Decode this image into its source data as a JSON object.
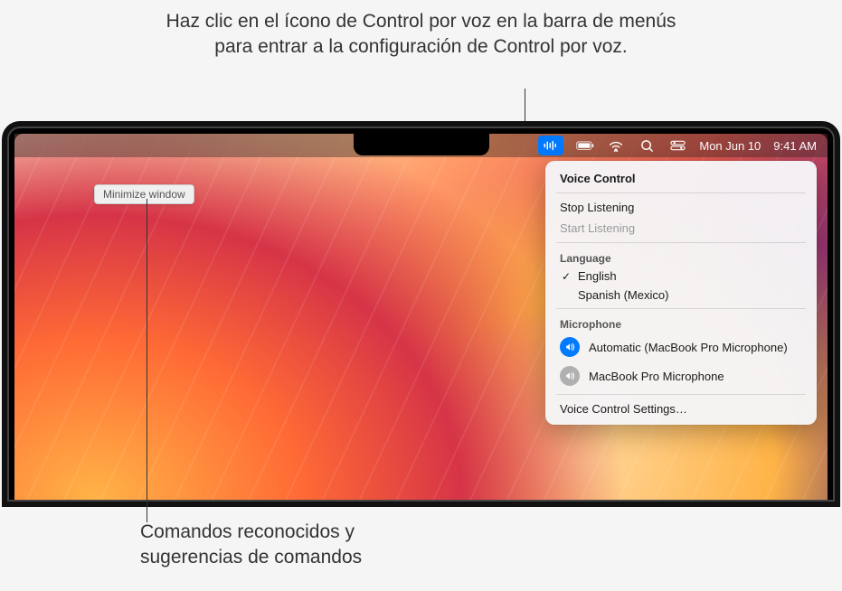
{
  "annotations": {
    "top": "Haz clic en el ícono de Control por voz en la barra de menús para entrar a la configuración de Control por voz.",
    "bottom_line1": "Comandos reconocidos y",
    "bottom_line2": "sugerencias de comandos"
  },
  "menubar": {
    "date": "Mon Jun 10",
    "time": "9:41 AM"
  },
  "command_bubble": "Minimize window",
  "panel": {
    "title": "Voice Control",
    "stop_listening": "Stop Listening",
    "start_listening": "Start Listening",
    "language_label": "Language",
    "languages": [
      {
        "name": "English",
        "selected": true
      },
      {
        "name": "Spanish (Mexico)",
        "selected": false
      }
    ],
    "microphone_label": "Microphone",
    "microphones": [
      {
        "name": "Automatic (MacBook Pro Microphone)",
        "active": true
      },
      {
        "name": "MacBook Pro Microphone",
        "active": false
      }
    ],
    "settings": "Voice Control Settings…"
  }
}
